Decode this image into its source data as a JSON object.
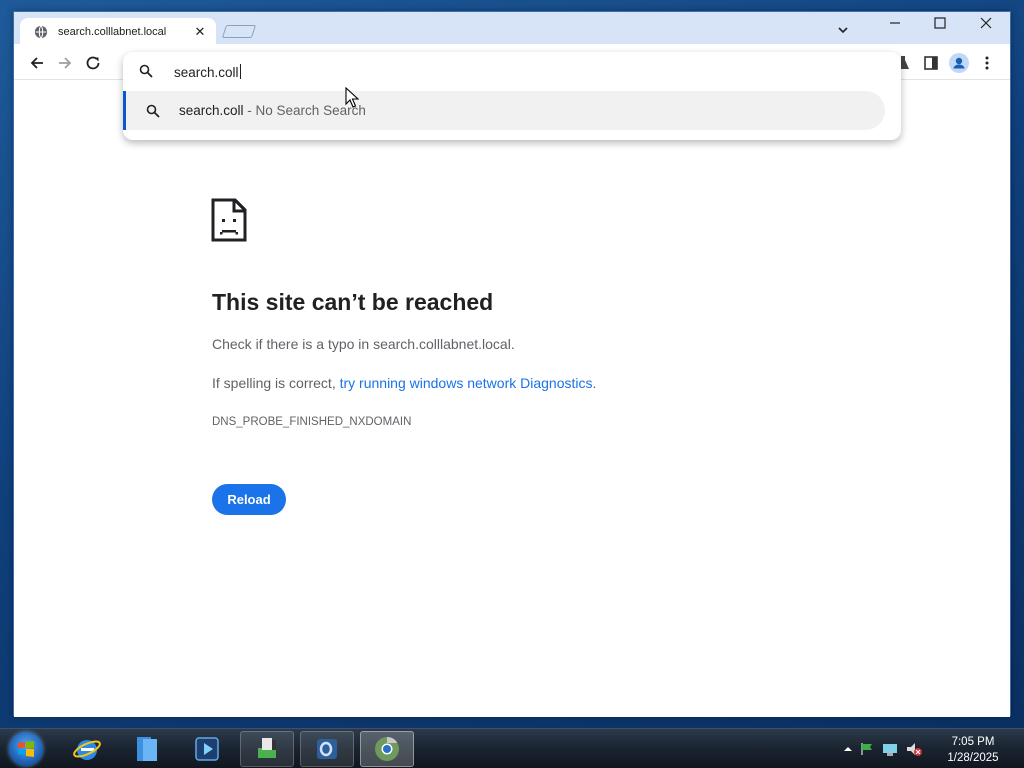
{
  "browser": {
    "tab": {
      "title": "search.colllabnet.local",
      "close_glyph": "✕"
    },
    "omnibox": {
      "input_value": "search.coll",
      "suggestion": {
        "query": "search.coll",
        "separator": " - ",
        "description": "No Search Search"
      }
    }
  },
  "error_page": {
    "title": "This site can’t be reached",
    "typo_message": "Check if there is a typo in search.colllabnet.local.",
    "spelling_prefix": "If spelling is correct, ",
    "diagnostics_link": "try running windows network Diagnostics",
    "spelling_suffix": ".",
    "error_code": "DNS_PROBE_FINISHED_NXDOMAIN",
    "reload_label": "Reload"
  },
  "taskbar": {
    "pinned": [
      "internet-explorer-icon",
      "file-explorer-icon",
      "media-player-icon",
      "app-green-icon",
      "outlook-icon",
      "chrome-icon"
    ],
    "clock": {
      "time": "7:05 PM",
      "date": "1/28/2025"
    }
  },
  "colors": {
    "accent": "#1a73e8",
    "focus_bar": "#0b57d0",
    "titlebar": "#d7e3f6",
    "desktop": "#1e5a9a"
  }
}
